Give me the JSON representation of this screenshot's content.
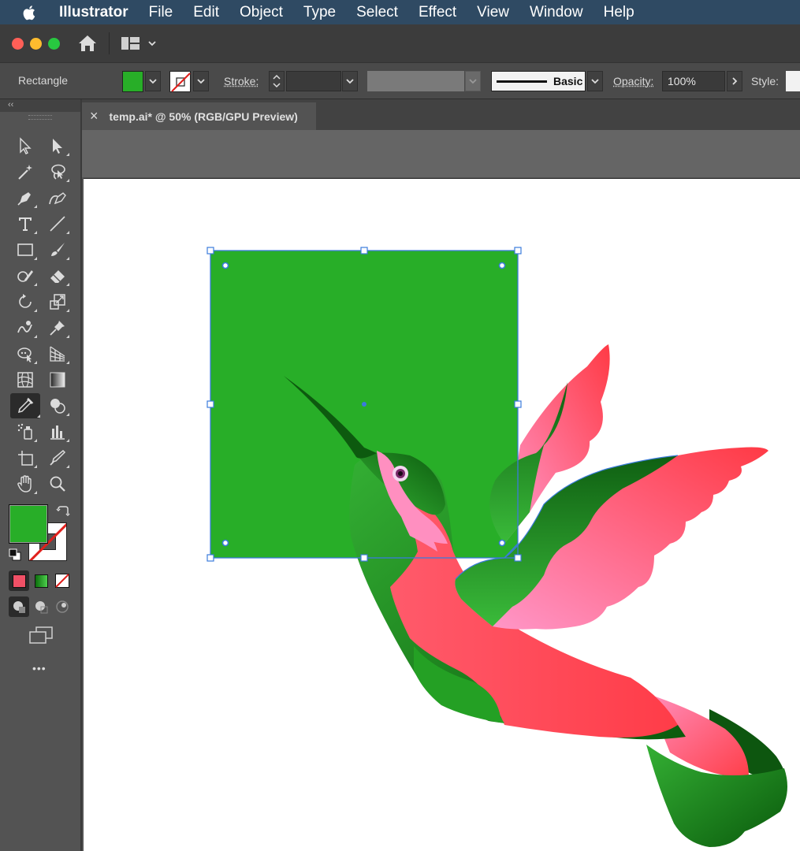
{
  "menubar": {
    "app_name": "Illustrator",
    "items": [
      "File",
      "Edit",
      "Object",
      "Type",
      "Select",
      "Effect",
      "View",
      "Window",
      "Help"
    ]
  },
  "controlbar": {
    "selection_label": "Rectangle",
    "stroke_label": "Stroke:",
    "brush_label": "Basic",
    "opacity_label": "Opacity:",
    "opacity_value": "100%",
    "style_label": "Style:"
  },
  "tabs": [
    {
      "title": "temp.ai* @ 50% (RGB/GPU Preview)",
      "close": "×"
    }
  ],
  "toolbar": {
    "collapse": "‹‹",
    "more": "•••"
  },
  "colors": {
    "fill": "#28ae28",
    "selection": "#3b7bdb",
    "bird_green": "#2a9a2a",
    "bird_dark": "#0e5a10",
    "bird_pink": "#ff5a6a",
    "bird_light_pink": "#ff8fb8"
  },
  "icons": [
    "apple-icon",
    "home-icon",
    "workspace-icon",
    "chevron-down-icon",
    "selection-tool-icon",
    "direct-selection-tool-icon",
    "magic-wand-tool-icon",
    "lasso-tool-icon",
    "pen-tool-icon",
    "curvature-tool-icon",
    "type-tool-icon",
    "line-tool-icon",
    "rectangle-tool-icon",
    "paintbrush-tool-icon",
    "shaper-tool-icon",
    "eraser-tool-icon",
    "rotate-tool-icon",
    "scale-tool-icon",
    "warp-tool-icon",
    "puppet-warp-tool-icon",
    "free-transform-tool-icon",
    "perspective-grid-tool-icon",
    "mesh-tool-icon",
    "gradient-tool-icon",
    "eyedropper-tool-icon",
    "shape-builder-tool-icon",
    "symbol-sprayer-tool-icon",
    "graph-tool-icon",
    "artboard-tool-icon",
    "slice-tool-icon",
    "hand-tool-icon",
    "zoom-tool-icon"
  ]
}
